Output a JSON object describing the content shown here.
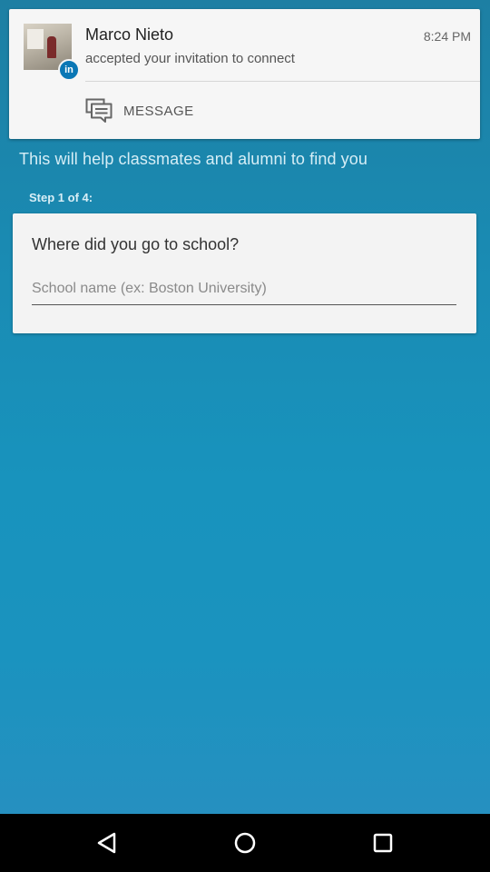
{
  "notification": {
    "name": "Marco Nieto",
    "time": "8:24 PM",
    "text": "accepted your invitation to connect",
    "action_label": "MESSAGE",
    "badge": "in",
    "icons": {
      "avatar": "profile-photo",
      "badge": "linkedin-icon",
      "action": "message-icon"
    }
  },
  "onboarding": {
    "subtitle": "This will help classmates and alumni to find you",
    "step": "Step 1 of 4:",
    "question": "Where did you go to school?",
    "school_input": {
      "value": "",
      "placeholder": "School name (ex: Boston University)"
    }
  },
  "navbar": {
    "icons": [
      "back-icon",
      "home-icon",
      "recent-apps-icon"
    ]
  },
  "colors": {
    "accent": "#0a77b5",
    "background_top": "#1d7fa3",
    "background_bottom": "#2a8fc0"
  }
}
